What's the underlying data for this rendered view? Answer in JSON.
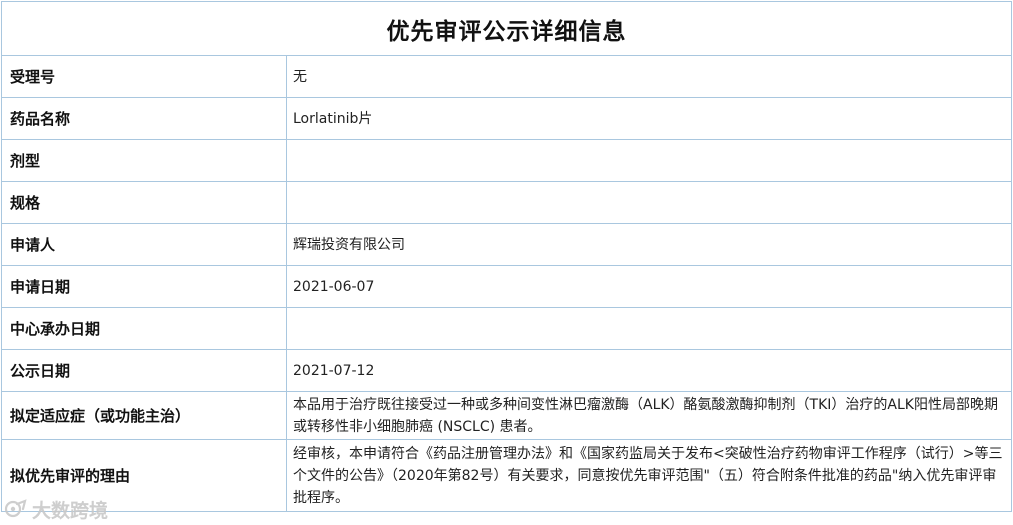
{
  "page_title": "优先审评公示详细信息",
  "rows": [
    {
      "label": "受理号",
      "value": "无"
    },
    {
      "label": "药品名称",
      "value": "Lorlatinib片"
    },
    {
      "label": "剂型",
      "value": ""
    },
    {
      "label": "规格",
      "value": ""
    },
    {
      "label": "申请人",
      "value": "辉瑞投资有限公司"
    },
    {
      "label": "申请日期",
      "value": "2021-06-07"
    },
    {
      "label": "中心承办日期",
      "value": ""
    },
    {
      "label": "公示日期",
      "value": "2021-07-12"
    },
    {
      "label": "拟定适应症（或功能主治）",
      "value": "本品用于治疗既往接受过一种或多种间变性淋巴瘤激酶（ALK）酪氨酸激酶抑制剂（TKI）治疗的ALK阳性局部晚期或转移性非小细胞肺癌 (NSCLC) 患者。"
    },
    {
      "label": "拟优先审评的理由",
      "value": "经审核，本申请符合《药品注册管理办法》和《国家药监局关于发布<突破性治疗药物审评工作程序（试行）>等三个文件的公告》（2020年第82号）有关要求，同意按优先审评范围\"（五）符合附条件批准的药品\"纳入优先审评审批程序。"
    }
  ],
  "watermark": {
    "text": "大数跨境",
    "icon": "brand-logo-icon"
  },
  "colors": {
    "border": "#a9c7df",
    "text": "#222222",
    "watermark": "#c9c9c9"
  }
}
